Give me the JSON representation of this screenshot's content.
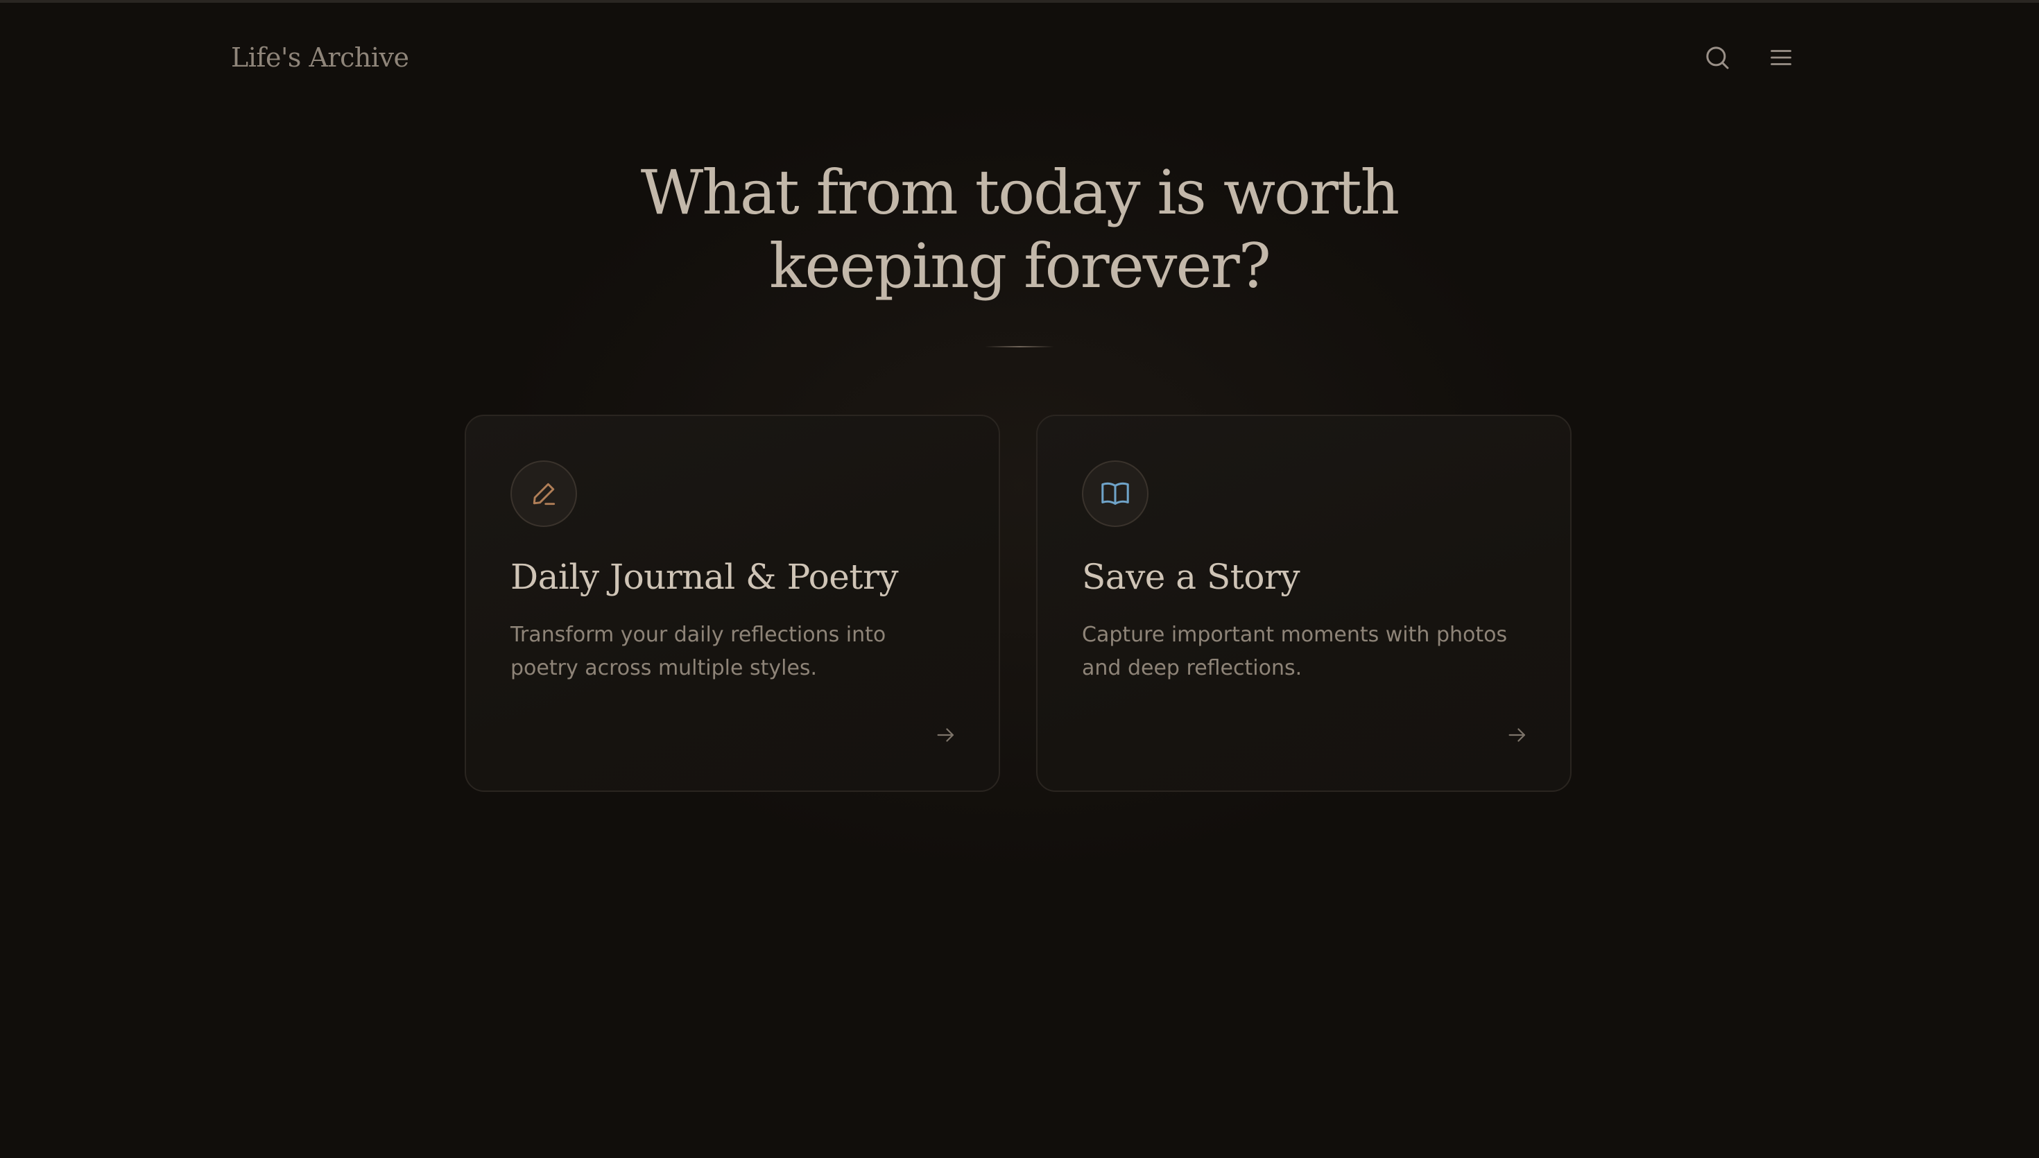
{
  "header": {
    "brand": "Life's Archive",
    "icons": [
      "search-icon",
      "menu-icon"
    ]
  },
  "hero": {
    "title_line_1": "What from today is worth",
    "title_line_2": "keeping forever?"
  },
  "cards": [
    {
      "icon": "pencil-icon",
      "icon_color": "#b07e57",
      "title": "Daily Journal & Poetry",
      "description": "Transform your daily reflections into poetry across multiple styles.",
      "arrow_icon": "arrow-right-icon"
    },
    {
      "icon": "book-open-icon",
      "icon_color": "#6fa3c8",
      "title": "Save a Story",
      "description": "Capture important moments with photos and deep reflections.",
      "arrow_icon": "arrow-right-icon"
    }
  ],
  "colors": {
    "background": "#110e0b",
    "text_primary": "#c3b8aa",
    "text_muted": "#8e8478",
    "card_border": "#2a2520"
  }
}
